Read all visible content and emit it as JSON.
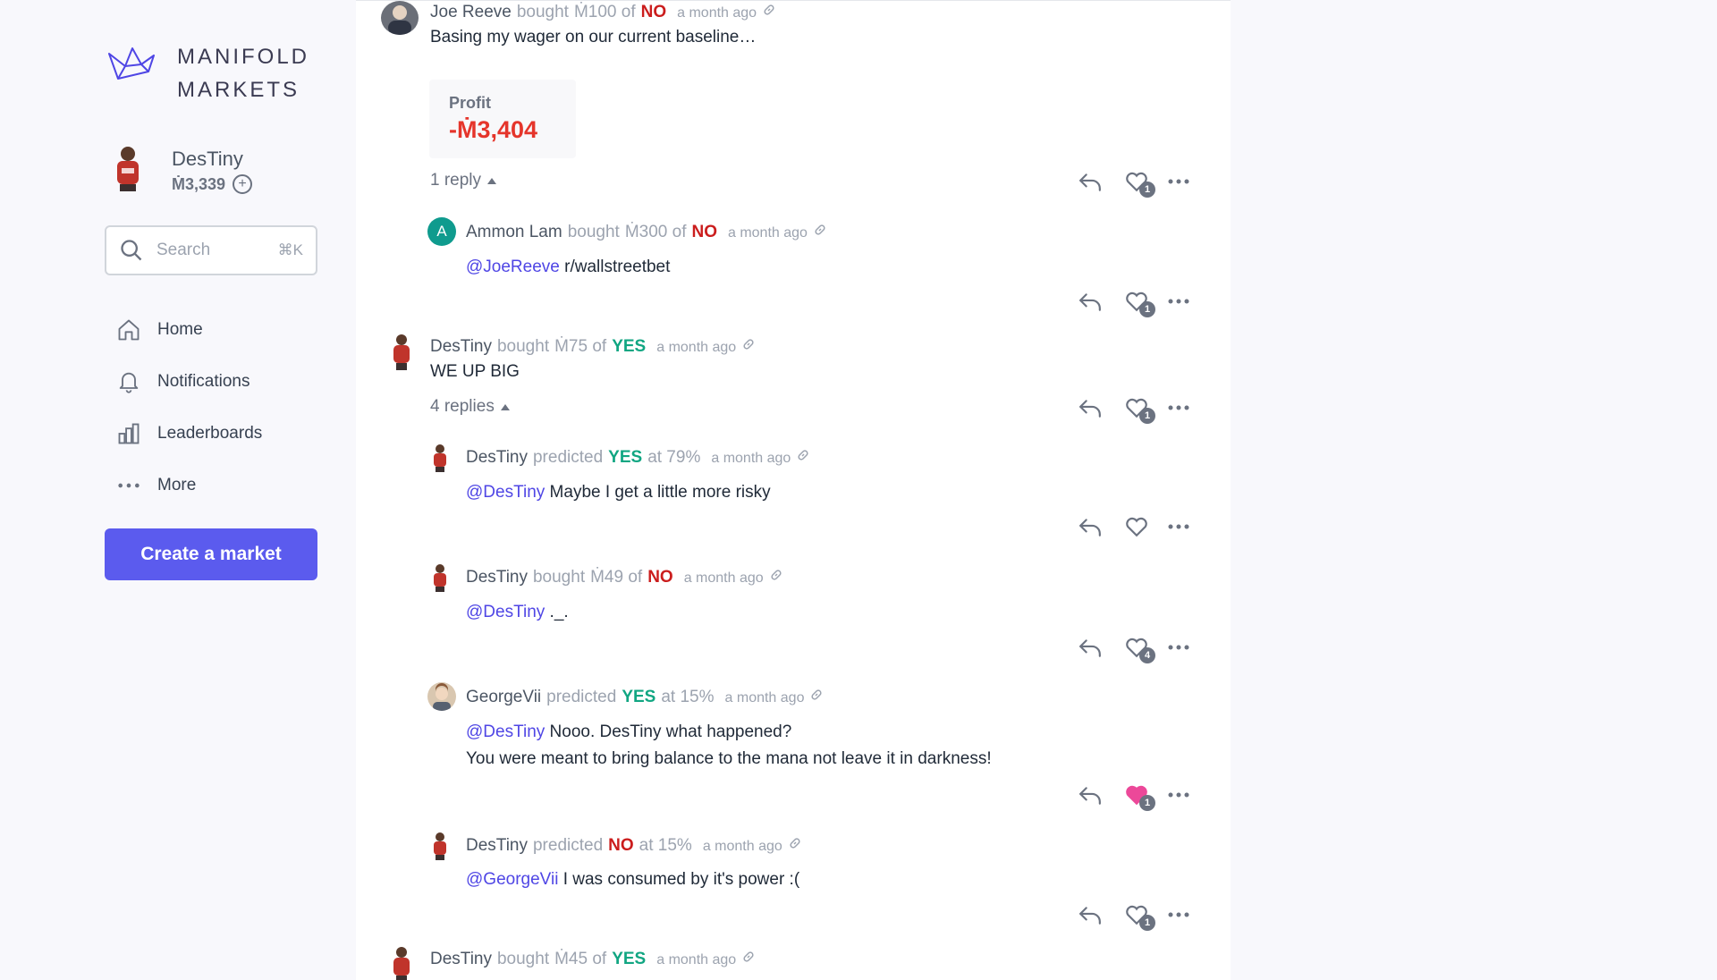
{
  "brand": {
    "line1": "MANIFOLD",
    "line2": "MARKETS"
  },
  "user": {
    "name": "DesTiny",
    "balance": "Ṁ3,339"
  },
  "search": {
    "placeholder": "Search",
    "shortcut": "⌘K"
  },
  "nav": {
    "items": [
      {
        "label": "Home",
        "icon": "home-icon"
      },
      {
        "label": "Notifications",
        "icon": "bell-icon"
      },
      {
        "label": "Leaderboards",
        "icon": "bar-chart-icon"
      },
      {
        "label": "More",
        "icon": "dots-icon"
      }
    ]
  },
  "create_button": "Create a market",
  "comments": [
    {
      "user": "Joe Reeve",
      "verb": "bought",
      "amount": "Ṁ100 of",
      "outcome": "NO",
      "time": "a month ago",
      "text": "Basing my wager on our current baseline…",
      "profit_label": "Profit",
      "profit_value": "-Ṁ3,404",
      "replies": "1 reply",
      "likes": "1"
    },
    {
      "user": "Ammon Lam",
      "avatar_letter": "A",
      "verb": "bought",
      "amount": "Ṁ300 of",
      "outcome": "NO",
      "time": "a month ago",
      "mention": "@JoeReeve",
      "text": " r/wallstreetbet",
      "likes": "1"
    },
    {
      "user": "DesTiny",
      "verb": "bought",
      "amount": "Ṁ75 of",
      "outcome": "YES",
      "time": "a month ago",
      "text": "WE UP BIG",
      "replies": "4 replies",
      "likes": "1"
    },
    {
      "user": "DesTiny",
      "verb": "predicted",
      "outcome": "YES",
      "at": "at 79%",
      "time": "a month ago",
      "mention": "@DesTiny",
      "text": " Maybe I get a little more risky"
    },
    {
      "user": "DesTiny",
      "verb": "bought",
      "amount": "Ṁ49 of",
      "outcome": "NO",
      "time": "a month ago",
      "mention": "@DesTiny",
      "text": " ._.",
      "likes": "4"
    },
    {
      "user": "GeorgeVii",
      "verb": "predicted",
      "outcome": "YES",
      "at": "at 15%",
      "time": "a month ago",
      "mention": "@DesTiny",
      "text": " Nooo. DesTiny what happened?",
      "text2": "You were meant to bring balance to the mana not leave it in darkness!",
      "likes": "1"
    },
    {
      "user": "DesTiny",
      "verb": "predicted",
      "outcome": "NO",
      "at": "at 15%",
      "time": "a month ago",
      "mention": "@GeorgeVii",
      "text": " I was consumed by it's power :(",
      "likes": "1"
    },
    {
      "user": "DesTiny",
      "verb": "bought",
      "amount": "Ṁ45 of",
      "outcome": "YES",
      "time": "a month ago"
    }
  ],
  "colors": {
    "accent": "#5b5bee",
    "yes": "#11a682",
    "no": "#cb1d1d",
    "mention": "#4f46e5",
    "liked": "#ec4899"
  }
}
